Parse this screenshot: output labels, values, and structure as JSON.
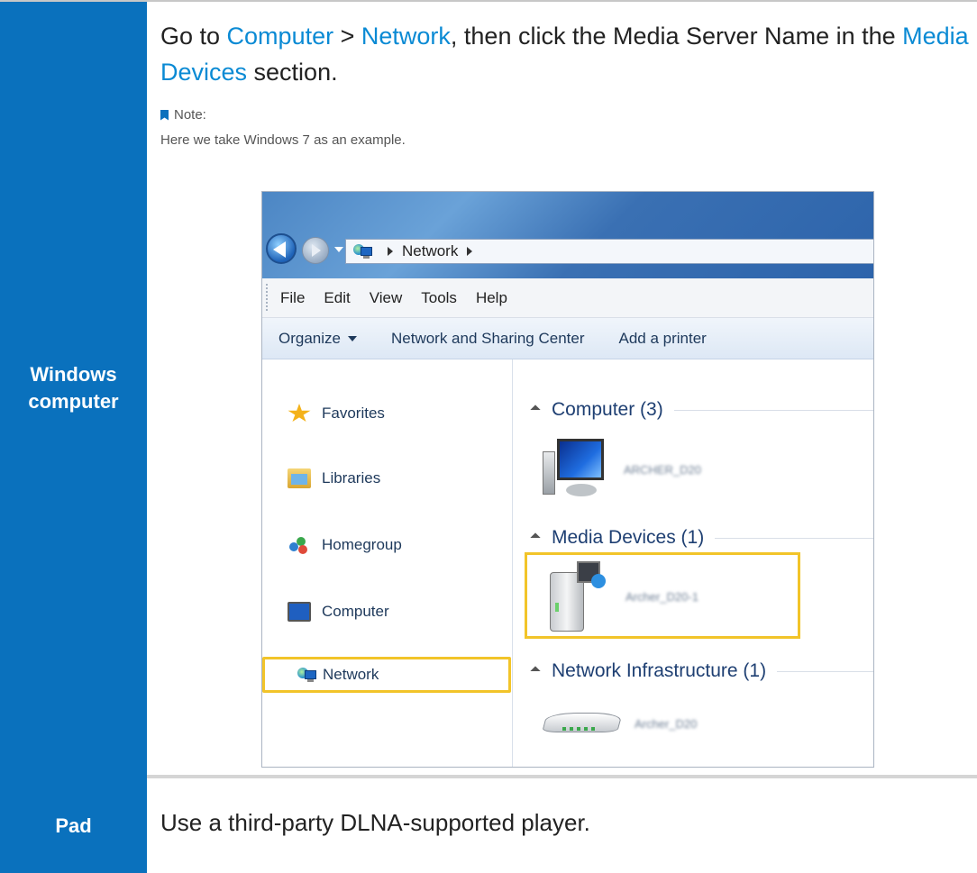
{
  "rows": [
    {
      "label": "Windows\ncomputer"
    },
    {
      "label": "Pad"
    }
  ],
  "instruction": {
    "part1": "Go to ",
    "link1": "Computer",
    "sep": " > ",
    "link2": "Network",
    "part2": ", then click the Media Server Name in the ",
    "link3": "Media Devices",
    "part3": " section."
  },
  "note": {
    "heading": "Note:",
    "text": "Here we take Windows 7 as an example."
  },
  "explorer": {
    "address": "Network",
    "menu": [
      "File",
      "Edit",
      "View",
      "Tools",
      "Help"
    ],
    "commands": [
      "Organize",
      "Network and Sharing Center",
      "Add a printer"
    ],
    "nav": [
      {
        "label": "Favorites",
        "icon": "star-icon"
      },
      {
        "label": "Libraries",
        "icon": "libraries-icon"
      },
      {
        "label": "Homegroup",
        "icon": "homegroup-icon"
      },
      {
        "label": "Computer",
        "icon": "computer-icon"
      },
      {
        "label": "Network",
        "icon": "network-icon",
        "selected": true
      }
    ],
    "groups": [
      {
        "title": "Computer (3)",
        "device": "ARCHER_D20"
      },
      {
        "title": "Media Devices (1)",
        "device": "Archer_D20-1"
      },
      {
        "title": "Network Infrastructure (1)",
        "device": "Archer_D20"
      }
    ]
  },
  "pad_text": "Use a third-party DLNA-supported player.",
  "colors": {
    "blue_cell": "#0a71bd",
    "link": "#0a8ad4",
    "highlight": "#f2c429"
  }
}
